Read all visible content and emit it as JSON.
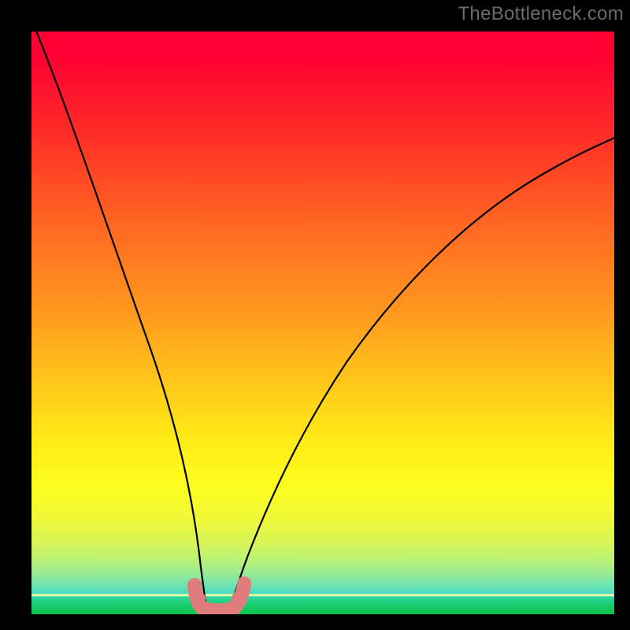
{
  "attribution": "TheBottleneck.com",
  "colors": {
    "curve": "#000000",
    "marker": "#e07c7c",
    "background_top": "#ff0033",
    "background_bottom": "#0bc453"
  },
  "chart_data": {
    "type": "line",
    "title": "",
    "xlabel": "",
    "ylabel": "",
    "xlim": [
      0,
      100
    ],
    "ylim": [
      0,
      100
    ],
    "grid": false,
    "legend": false,
    "annotations": [
      "TheBottleneck.com"
    ],
    "series": [
      {
        "name": "left-branch",
        "x": [
          0,
          4,
          8,
          12,
          16,
          20,
          23,
          25.5,
          27,
          28.2,
          29.2,
          30
        ],
        "values": [
          102,
          89,
          76,
          63,
          50,
          36,
          24,
          14,
          8,
          4,
          1.5,
          0.5
        ]
      },
      {
        "name": "right-branch",
        "x": [
          34,
          35,
          36.5,
          38.5,
          41,
          45,
          50,
          56,
          63,
          72,
          82,
          92,
          100
        ],
        "values": [
          0.5,
          1.5,
          4,
          8,
          13,
          22,
          32,
          42,
          52,
          62,
          71,
          78,
          83
        ]
      },
      {
        "name": "bottom-u-marker",
        "x": [
          28.2,
          29.2,
          30,
          31,
          32,
          33,
          34,
          35,
          36.5
        ],
        "values": [
          4,
          1.5,
          0.5,
          0,
          0,
          0,
          0.5,
          1.5,
          4
        ]
      }
    ]
  }
}
